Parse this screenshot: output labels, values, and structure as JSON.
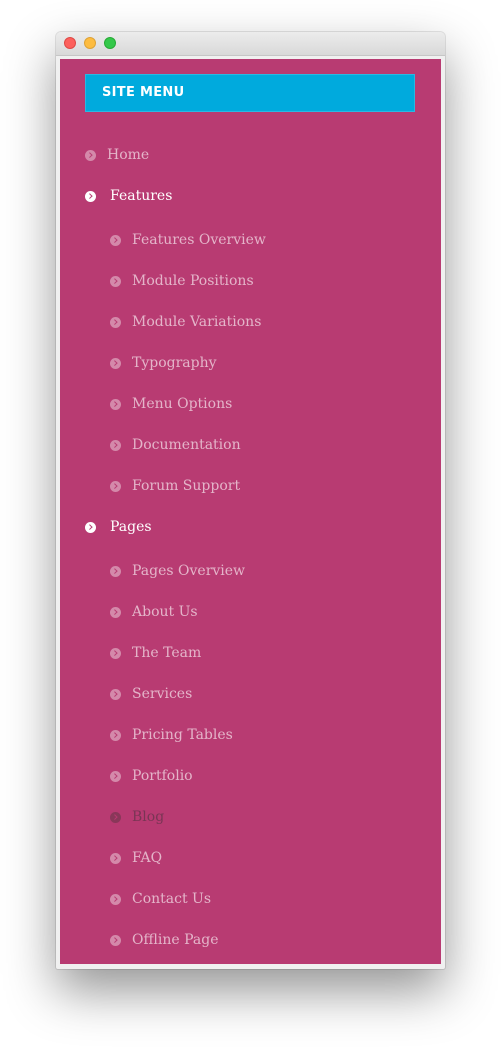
{
  "menu": {
    "title": "SITE MENU",
    "items": [
      {
        "label": "Home",
        "type": "top"
      },
      {
        "label": "Features",
        "type": "parent"
      },
      {
        "label": "Features Overview",
        "type": "child"
      },
      {
        "label": "Module Positions",
        "type": "child"
      },
      {
        "label": "Module Variations",
        "type": "child"
      },
      {
        "label": "Typography",
        "type": "child"
      },
      {
        "label": "Menu Options",
        "type": "child"
      },
      {
        "label": "Documentation",
        "type": "child"
      },
      {
        "label": "Forum Support",
        "type": "child"
      },
      {
        "label": "Pages",
        "type": "parent"
      },
      {
        "label": "Pages Overview",
        "type": "child"
      },
      {
        "label": "About Us",
        "type": "child"
      },
      {
        "label": "The Team",
        "type": "child"
      },
      {
        "label": "Services",
        "type": "child"
      },
      {
        "label": "Pricing Tables",
        "type": "child"
      },
      {
        "label": "Portfolio",
        "type": "child"
      },
      {
        "label": "Blog",
        "type": "child",
        "active": true
      },
      {
        "label": "FAQ",
        "type": "child"
      },
      {
        "label": "Contact Us",
        "type": "child"
      },
      {
        "label": "Offline Page",
        "type": "child"
      }
    ]
  },
  "colors": {
    "background": "#b83b72",
    "header": "#00aadd",
    "text_muted": "#e6aac5",
    "text_parent": "#ffffff"
  }
}
